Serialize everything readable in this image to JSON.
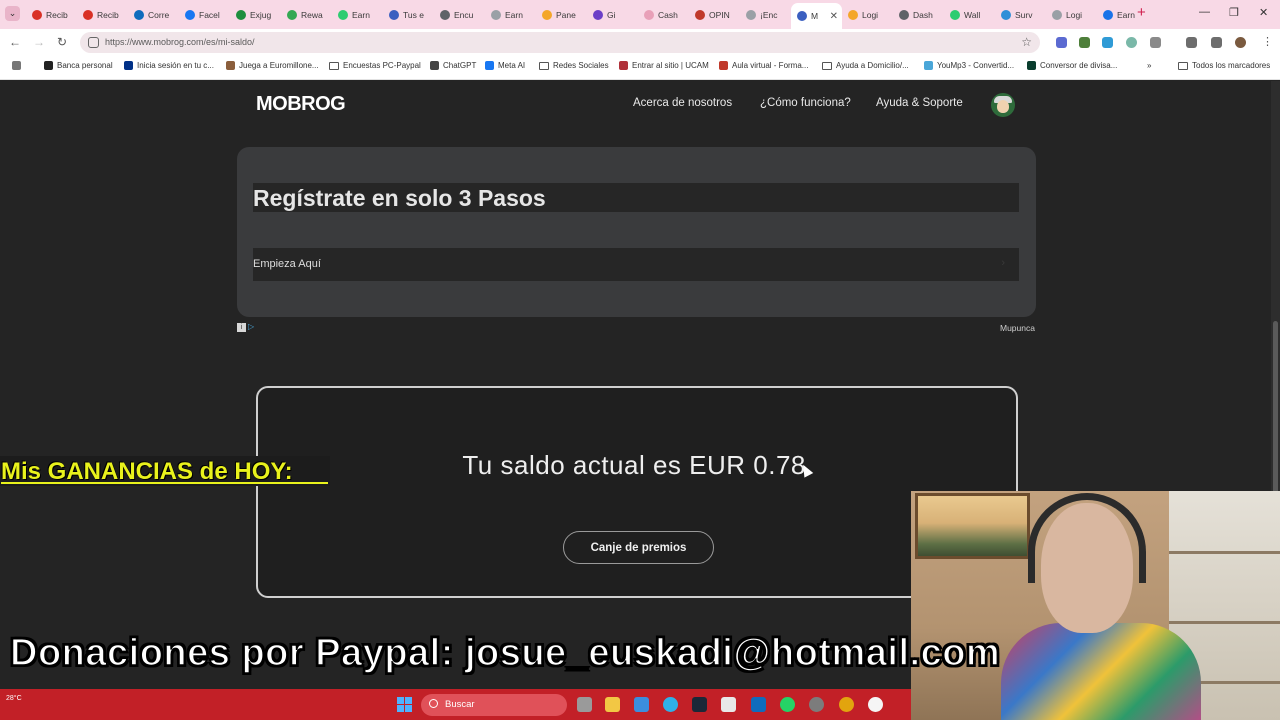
{
  "browser": {
    "tabs": [
      {
        "label": "Recib",
        "color": "#d93025"
      },
      {
        "label": "Recib",
        "color": "#d93025"
      },
      {
        "label": "Corre",
        "color": "#0f6cbd"
      },
      {
        "label": "Facel",
        "color": "#1877f2"
      },
      {
        "label": "Exjug",
        "color": "#1e8e3e"
      },
      {
        "label": "Rewa",
        "color": "#34a853"
      },
      {
        "label": "Earn",
        "color": "#2ecc71"
      },
      {
        "label": "Tus e",
        "color": "#3b5fc0"
      },
      {
        "label": "Encu",
        "color": "#5f6368"
      },
      {
        "label": "Earn",
        "color": "#9aa0a6"
      },
      {
        "label": "Pane",
        "color": "#f4a62a"
      },
      {
        "label": "Gi",
        "color": "#6c3fc7"
      },
      {
        "label": "Cash",
        "color": "#e8a0b8"
      },
      {
        "label": "OPIN",
        "color": "#c0392b"
      },
      {
        "label": "¡Enc",
        "color": "#9aa0a6"
      },
      {
        "label": "M",
        "color": "#3b5fc0"
      },
      {
        "label": "Logi",
        "color": "#f4a62a"
      },
      {
        "label": "Dash",
        "color": "#5f6368"
      },
      {
        "label": "Wall",
        "color": "#2ecc71"
      },
      {
        "label": "Surv",
        "color": "#2f8fd8"
      },
      {
        "label": "Logi",
        "color": "#9aa0a6"
      },
      {
        "label": "Earn",
        "color": "#1a73e8"
      }
    ],
    "active_tab_index": 15,
    "url": "https://www.mobrog.com/es/mi-saldo/",
    "bookmarks": [
      {
        "label": "Banca personal",
        "icon": "k-icon",
        "color": "#222222"
      },
      {
        "label": "Inicia sesión en tu c...",
        "icon": "paypal-icon",
        "color": "#003087"
      },
      {
        "label": "Juega a Euromillone...",
        "icon": "lottery-icon",
        "color": "#8b5e3c"
      },
      {
        "label": "Encuestas PC-Paypal",
        "icon": "folder-icon",
        "color": ""
      },
      {
        "label": "ChatGPT",
        "icon": "chatgpt-icon",
        "color": "#444444"
      },
      {
        "label": "Meta AI",
        "icon": "meta-ai-icon",
        "color": "#1877f2"
      },
      {
        "label": "Redes Sociales",
        "icon": "folder-icon",
        "color": ""
      },
      {
        "label": "Entrar al sitio | UCAM",
        "icon": "ucam-icon",
        "color": "#b0313a"
      },
      {
        "label": "Aula virtual - Forma...",
        "icon": "aula-icon",
        "color": "#c0392b"
      },
      {
        "label": "Ayuda a Domicilio/...",
        "icon": "folder-icon",
        "color": ""
      },
      {
        "label": "YouMp3 - Convertid...",
        "icon": "yoump3-icon",
        "color": "#4aa6d8"
      },
      {
        "label": "Conversor de divisa...",
        "icon": "currency-icon",
        "color": "#0a3d2e"
      }
    ],
    "all_bookmarks": "Todos los marcadores"
  },
  "site": {
    "logo": "MOBROG",
    "nav": [
      "Acerca de nosotros",
      "¿Cómo funciona?",
      "Ayuda & Soporte"
    ]
  },
  "ad": {
    "title": "Regístrate en solo 3 Pasos",
    "button": "Empieza Aquí",
    "sponsor": "Mupunca"
  },
  "balance": {
    "text": "Tu saldo actual es EUR 0.78.",
    "redeem_button": "Canje de premios"
  },
  "overlays": {
    "today": "Mis GANANCIAS de HOY:",
    "donate": "Donaciones por Paypal:  josue_euskadi@hotmail.com"
  },
  "taskbar": {
    "weather": "28°C",
    "search": "Buscar"
  }
}
